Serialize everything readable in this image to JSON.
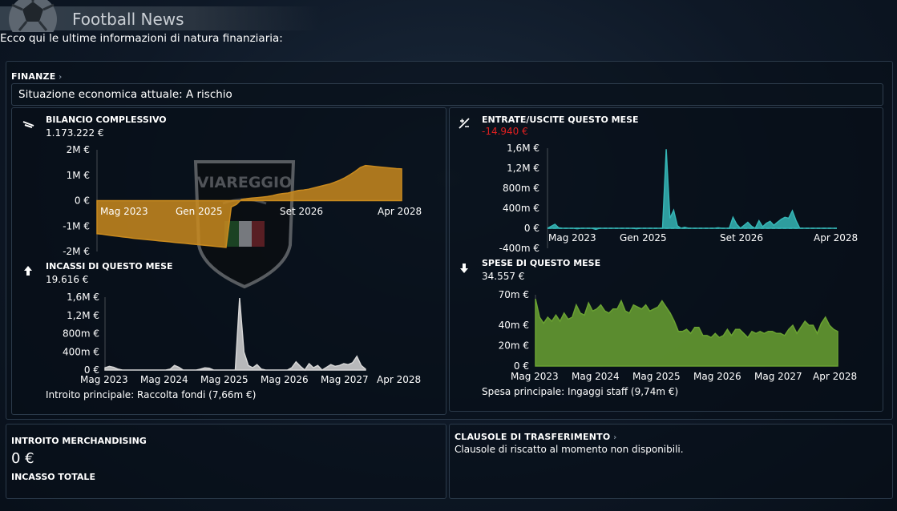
{
  "header": {
    "title": "Football News",
    "subtitle": "Ecco qui le ultime informazioni di natura finanziaria:"
  },
  "finanze": {
    "title": "FINANZE",
    "status": "Situazione economica attuale: A rischio"
  },
  "crest_text": "VIAREGGIO",
  "bilancio": {
    "label": "BILANCIO COMPLESSIVO",
    "value": "1.173.222 €",
    "y_ticks": [
      "2M €",
      "1M €",
      "0 €",
      "-1M €",
      "-2M €"
    ],
    "x_ticks": [
      "Mag 2023",
      "Gen 2025",
      "Set 2026",
      "Apr 2028"
    ]
  },
  "entrate_uscite": {
    "label": "ENTRATE/USCITE QUESTO MESE",
    "value": "-14.940 €",
    "y_ticks": [
      "1,6M €",
      "1,2M €",
      "800m €",
      "400m €",
      "0 €",
      "-400m €"
    ],
    "x_ticks": [
      "Mag 2023",
      "Gen 2025",
      "Set 2026",
      "Apr 2028"
    ]
  },
  "incassi": {
    "label": "INCASSI DI QUESTO MESE",
    "value": "19.616 €",
    "y_ticks": [
      "1,6M €",
      "1,2M €",
      "800m €",
      "400m €",
      "0 €"
    ],
    "x_ticks": [
      "Mag 2023",
      "Mag 2024",
      "Mag 2025",
      "Mag 2026",
      "Mag 2027",
      "Apr 2028"
    ],
    "note_label": "Introito principale:",
    "note_value": "Raccolta fondi (7,66m €)"
  },
  "spese": {
    "label": "SPESE DI QUESTO MESE",
    "value": "34.557 €",
    "y_ticks": [
      "70m €",
      "40m €",
      "20m €",
      "0 €"
    ],
    "x_ticks": [
      "Mag 2023",
      "Mag 2024",
      "Mag 2025",
      "Mag 2026",
      "Mag 2027",
      "Apr 2028"
    ],
    "note_label": "Spesa principale:",
    "note_value": "Ingaggi staff (9,74m €)"
  },
  "merchandising": {
    "label": "INTROITO MERCHANDISING",
    "value": "0 €",
    "total_label": "INCASSO TOTALE"
  },
  "clausole": {
    "title": "CLAUSOLE DI TRASFERIMENTO",
    "text": "Clausole di riscatto al momento non disponibili."
  },
  "colors": {
    "bilancio": "#c98a1e",
    "entrate": "#35b6b6",
    "incassi": "#d6d6d6",
    "spese": "#6aa232",
    "negative": "#e02020"
  },
  "chart_data": [
    {
      "type": "area",
      "name": "bilancio",
      "x": [
        0,
        1,
        2,
        3,
        4,
        5,
        6,
        7,
        8,
        9,
        10,
        11,
        12,
        13,
        14,
        15,
        16,
        17,
        18,
        19,
        20,
        21,
        22,
        23,
        24,
        25,
        26,
        27,
        28,
        29,
        30,
        31,
        32,
        33,
        34,
        35,
        36,
        37,
        38,
        39,
        40,
        41,
        42,
        43,
        44,
        45,
        46,
        47,
        48,
        49,
        50,
        51,
        52,
        53,
        54,
        55,
        56,
        57,
        58,
        59
      ],
      "x_tick_labels": [
        "Mag 2023",
        "Gen 2025",
        "Set 2026",
        "Apr 2028"
      ],
      "y": [
        -1.3,
        -1.32,
        -1.35,
        -1.38,
        -1.4,
        -1.43,
        -1.45,
        -1.48,
        -1.5,
        -1.52,
        -1.54,
        -1.56,
        -1.58,
        -1.6,
        -1.62,
        -1.64,
        -1.66,
        -1.68,
        -1.7,
        -1.72,
        -1.74,
        -1.76,
        -1.78,
        -1.8,
        -1.82,
        -1.84,
        -0.25,
        -0.15,
        0.05,
        0.08,
        0.1,
        0.12,
        0.14,
        0.16,
        0.2,
        0.25,
        0.28,
        0.3,
        0.35,
        0.4,
        0.42,
        0.45,
        0.5,
        0.55,
        0.6,
        0.65,
        0.72,
        0.8,
        0.9,
        1.02,
        1.15,
        1.3,
        1.38,
        1.36,
        1.34,
        1.32,
        1.3,
        1.28,
        1.26,
        1.25
      ],
      "ylim": [
        -2,
        2
      ],
      "y_unit": "M €"
    },
    {
      "type": "area",
      "name": "entrate/uscite",
      "x_tick_labels": [
        "Mag 2023",
        "Gen 2025",
        "Set 2026",
        "Apr 2028"
      ],
      "y": [
        0,
        0.04,
        0.08,
        0.01,
        0,
        0,
        0,
        0,
        -0.01,
        0,
        0,
        0,
        0,
        -0.02,
        0,
        0,
        0,
        0,
        0,
        0,
        0,
        0,
        0,
        0,
        -0.01,
        0,
        0,
        0,
        0,
        0,
        0,
        0,
        1.58,
        0.2,
        0.36,
        0.05,
        0,
        0.02,
        0,
        0,
        0,
        0,
        0,
        0,
        0,
        0,
        0.01,
        0,
        0,
        0,
        0.22,
        0.08,
        0,
        0.06,
        0.12,
        0.04,
        0,
        0.15,
        0.03,
        0.1,
        0.14,
        0.06,
        0.12,
        0.18,
        0.22,
        0.2,
        0.35,
        0.15,
        0,
        0,
        0,
        0,
        0,
        0,
        0,
        0,
        0,
        0,
        0
      ],
      "ylim": [
        -0.4,
        1.6
      ],
      "y_unit": "M €"
    },
    {
      "type": "area",
      "name": "incassi",
      "x_tick_labels": [
        "Mag 2023",
        "Mag 2024",
        "Mag 2025",
        "Mag 2026",
        "Mag 2027",
        "Apr 2028"
      ],
      "y": [
        0.05,
        0.08,
        0.06,
        0.02,
        0,
        0,
        0,
        0,
        0,
        0,
        0,
        0,
        0,
        0,
        0,
        0.02,
        0.1,
        0.06,
        0,
        0,
        0,
        0,
        0.02,
        0.05,
        0.04,
        0,
        0,
        0,
        0,
        0,
        0,
        1.58,
        0.4,
        0.1,
        0.05,
        0.12,
        0.02,
        0,
        0,
        0,
        0,
        0,
        0,
        0.05,
        0.18,
        0.08,
        0,
        0.14,
        0.05,
        0.1,
        0,
        0.06,
        0.12,
        0.08,
        0.1,
        0.14,
        0.12,
        0.16,
        0.3,
        0.1,
        0.02
      ],
      "ylim": [
        0,
        1.6
      ],
      "y_unit": "M €"
    },
    {
      "type": "area",
      "name": "spese",
      "x_tick_labels": [
        "Mag 2023",
        "Mag 2024",
        "Mag 2025",
        "Mag 2026",
        "Mag 2027",
        "Apr 2028"
      ],
      "y": [
        66,
        48,
        42,
        48,
        44,
        50,
        44,
        52,
        46,
        48,
        60,
        52,
        50,
        62,
        54,
        56,
        60,
        54,
        52,
        56,
        56,
        64,
        54,
        52,
        60,
        58,
        56,
        60,
        54,
        56,
        58,
        64,
        58,
        52,
        44,
        34,
        34,
        36,
        32,
        38,
        38,
        30,
        30,
        28,
        32,
        28,
        30,
        36,
        30,
        36,
        36,
        32,
        28,
        34,
        32,
        34,
        32,
        34,
        34,
        32,
        32,
        30,
        36,
        40,
        32,
        38,
        44,
        40,
        40,
        32,
        42,
        48,
        40,
        36,
        34
      ],
      "ylim": [
        0,
        70
      ],
      "y_unit": "m €"
    }
  ]
}
